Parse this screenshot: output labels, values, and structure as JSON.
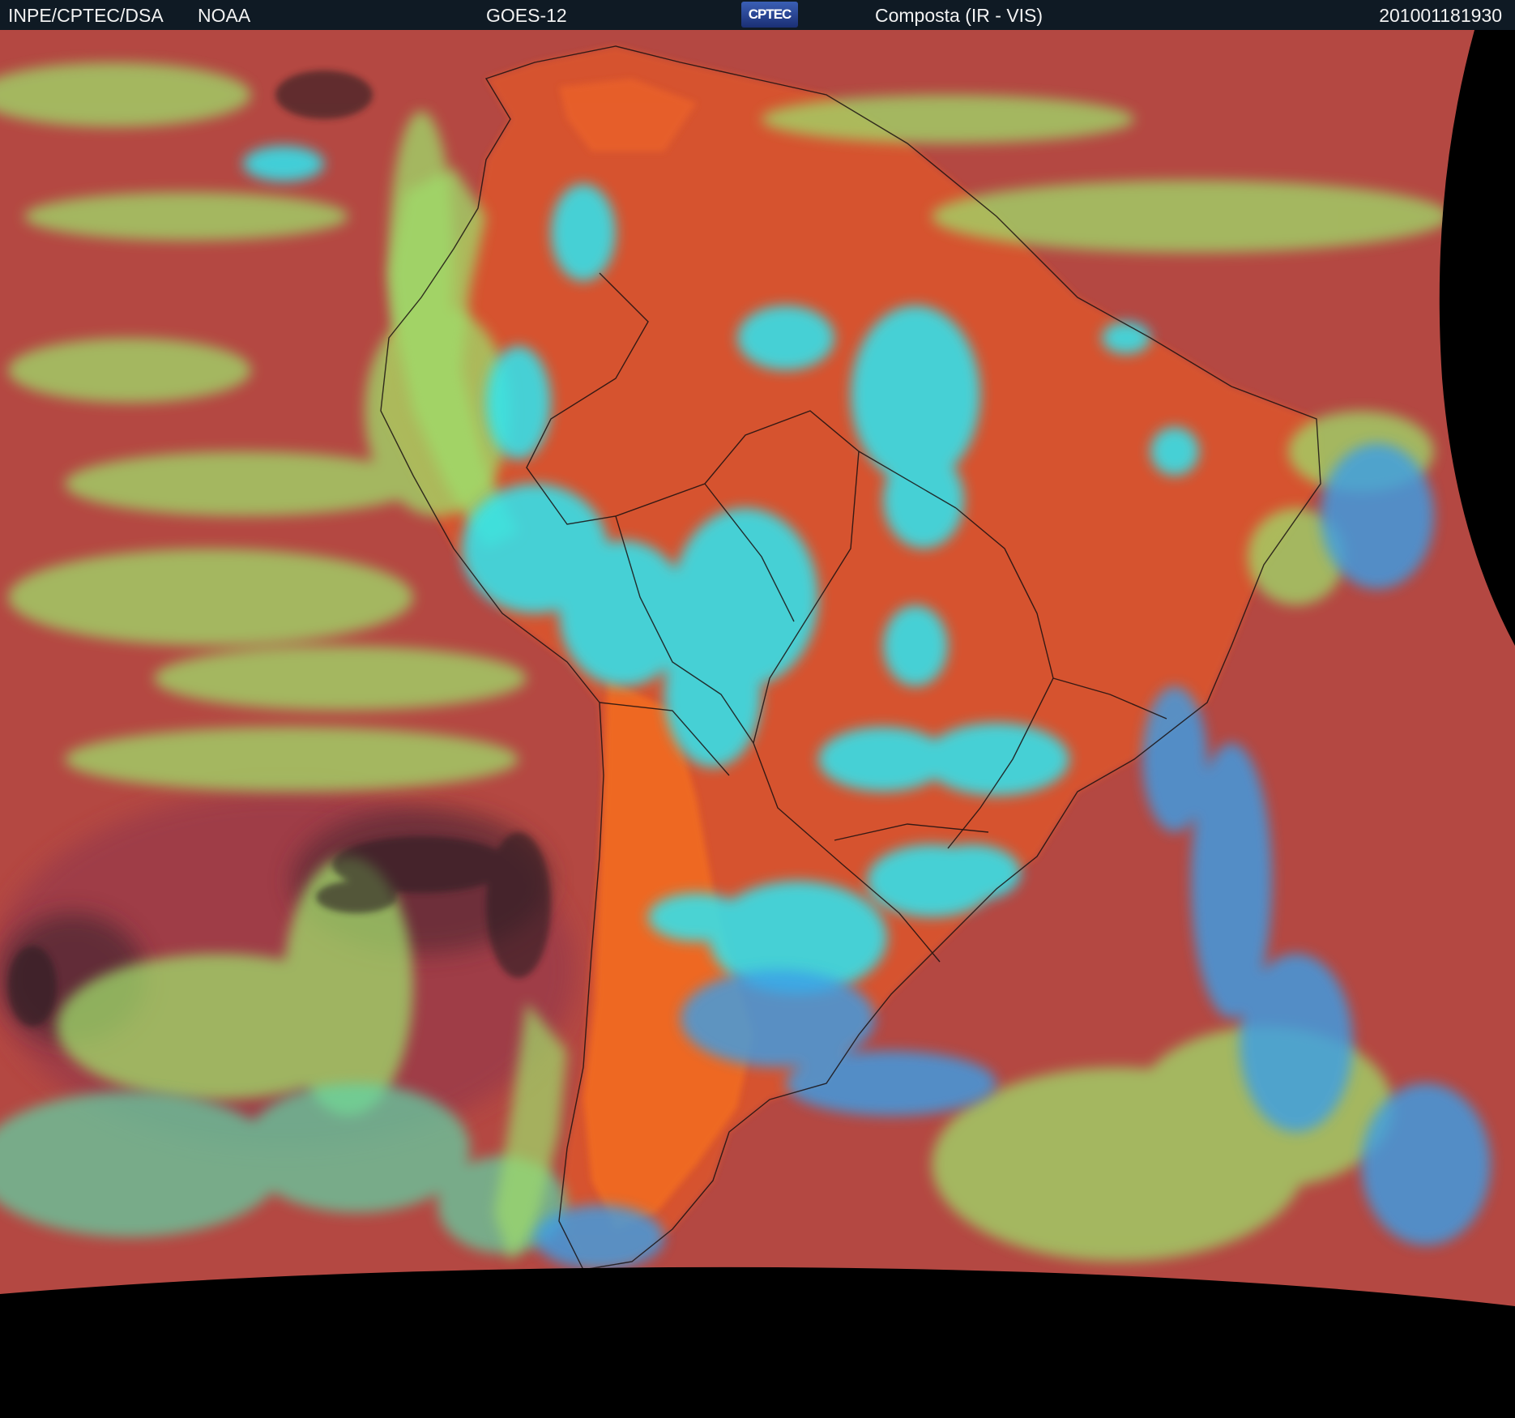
{
  "header": {
    "org": "INPE/CPTEC/DSA",
    "agency": "NOAA",
    "satellite": "GOES-12",
    "logo_text": "CPTEC",
    "product": "Composta (IR - VIS)",
    "timestamp": "201001181930"
  },
  "colors": {
    "header_bg": "#0f1a24",
    "ocean_red": "#b44842",
    "land_orange": "#d9552e",
    "andes_orange": "#f06a22",
    "low_cloud_green": "#9fdc6a",
    "high_cloud_cyan": "#2fe6f2",
    "mid_cloud_blue": "#3b9fe8",
    "clear_dark": "#2a1f22",
    "space": "#000000"
  }
}
